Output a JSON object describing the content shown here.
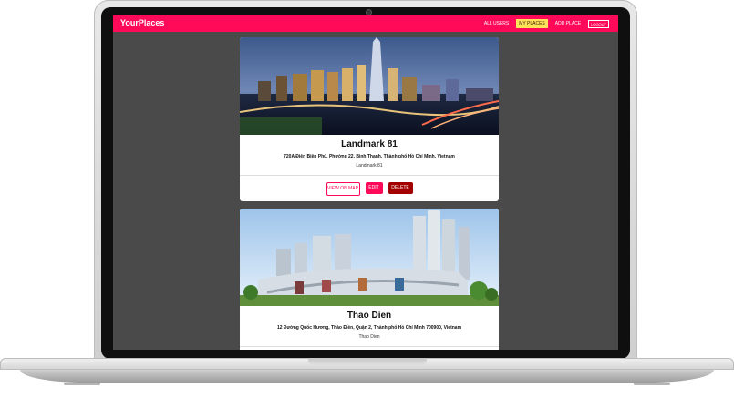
{
  "header": {
    "brand": "YourPlaces",
    "nav": {
      "all_users": "ALL USERS",
      "my_places": "MY PLACES",
      "add_place": "ADD PLACE",
      "logout": "LOGOUT"
    }
  },
  "places": [
    {
      "title": "Landmark 81",
      "address": "720A Điện Biên Phủ, Phường 22, Bình Thạnh, Thành phố Hồ Chí Minh, Vietnam",
      "description": "Landmark 81",
      "actions": {
        "view_on_map": "VIEW ON MAP",
        "edit": "EDIT",
        "delete": "DELETE"
      }
    },
    {
      "title": "Thao Dien",
      "address": "12 Đường Quốc Hương, Thảo Điền, Quận 2, Thành phố Hồ Chí Minh 700900, Vietnam",
      "description": "Thao Dien"
    }
  ],
  "colors": {
    "brand": "#ff0a59",
    "active_nav": "#ffe15a",
    "delete": "#a30000",
    "screen_bg": "#4a4a4a"
  }
}
